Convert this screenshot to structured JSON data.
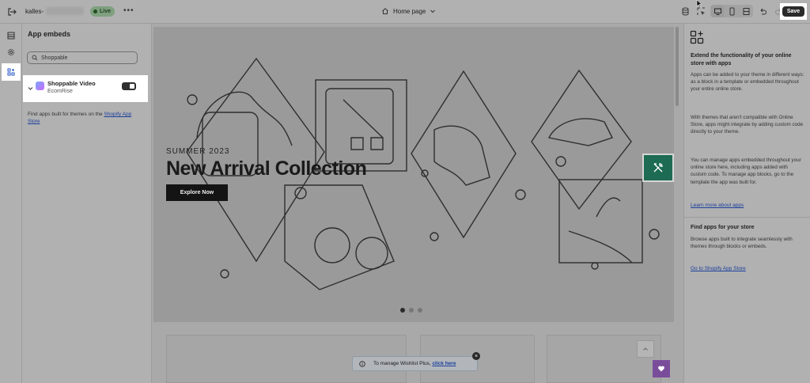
{
  "topbar": {
    "store_name": "kalles-",
    "live_label": "Live",
    "more_label": "•••",
    "page_label": "Home page",
    "save_label": "Save"
  },
  "left_panel": {
    "title": "App embeds",
    "search_value": "Shoppable",
    "embed": {
      "name": "Shoppable Video",
      "vendor": "EcomRise",
      "enabled": true
    },
    "note_prefix": "Find apps built for themes on the",
    "note_link": "Shopify App Store"
  },
  "preview": {
    "hero_subtitle": "SUMMER 2023",
    "hero_title": "New Arrival Collection",
    "hero_button": "Explore Now",
    "slide_count": 3,
    "active_slide": 1,
    "wishlist_text": "To manage Wishlist Plus,",
    "wishlist_link": "click here",
    "accent_color": "#1d6b52"
  },
  "right_panel": {
    "heading1": "Extend the functionality of your online store with apps",
    "para1": "Apps can be added to your theme in different ways: as a block in a template or embedded throughout your entire online store.",
    "para2": "With themes that aren't compatible with Online Store, apps might integrate by adding custom code directly to your theme.",
    "para3": "You can manage apps embedded throughout your online store here, including apps added with custom code. To manage app blocks, go to the template the app was built for.",
    "link1": "Learn more about apps",
    "heading2": "Find apps for your store",
    "para4": "Browse apps built to integrate seamlessly with themes through blocks or embeds.",
    "link2": "Go to Shopify App Store"
  }
}
